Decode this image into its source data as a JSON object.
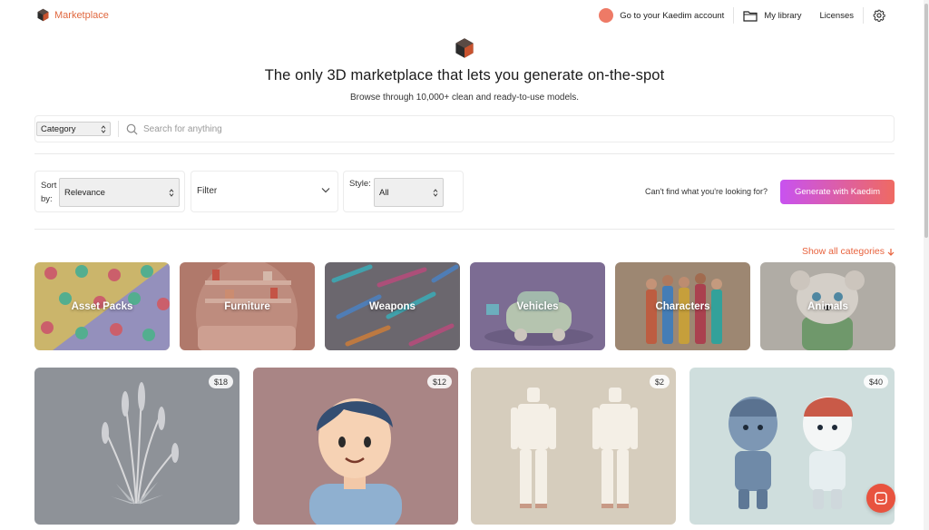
{
  "header": {
    "brand": "Marketplace",
    "account_link": "Go to your Kaedim account",
    "library_link": "My library",
    "licenses_link": "Licenses",
    "icons": [
      "kaedim-logo-icon",
      "library-icon",
      "gear-icon"
    ]
  },
  "hero": {
    "title": "The only 3D marketplace that lets you generate on-the-spot",
    "subtitle": "Browse through 10,000+ clean and ready-to-use models."
  },
  "search": {
    "category_value": "Category",
    "placeholder": "Search for anything"
  },
  "filters": {
    "sort_label": "Sort by:",
    "sort_value": "Relevance",
    "filter_label": "Filter",
    "style_label": "Style:",
    "style_value": "All",
    "cant_find": "Can't find what you're looking for?",
    "generate_button": "Generate with Kaedim"
  },
  "categories": {
    "show_all": "Show all categories",
    "items": [
      {
        "label": "Asset Packs"
      },
      {
        "label": "Furniture"
      },
      {
        "label": "Weapons"
      },
      {
        "label": "Vehicles"
      },
      {
        "label": "Characters"
      },
      {
        "label": "Animals"
      }
    ]
  },
  "products": [
    {
      "price": "$18"
    },
    {
      "price": "$12"
    },
    {
      "price": "$2"
    },
    {
      "price": "$40"
    }
  ],
  "colors": {
    "brand_orange": "#e0683f",
    "gradient_start": "#c852f0",
    "gradient_end": "#ef6a62",
    "chat": "#e8533f"
  }
}
